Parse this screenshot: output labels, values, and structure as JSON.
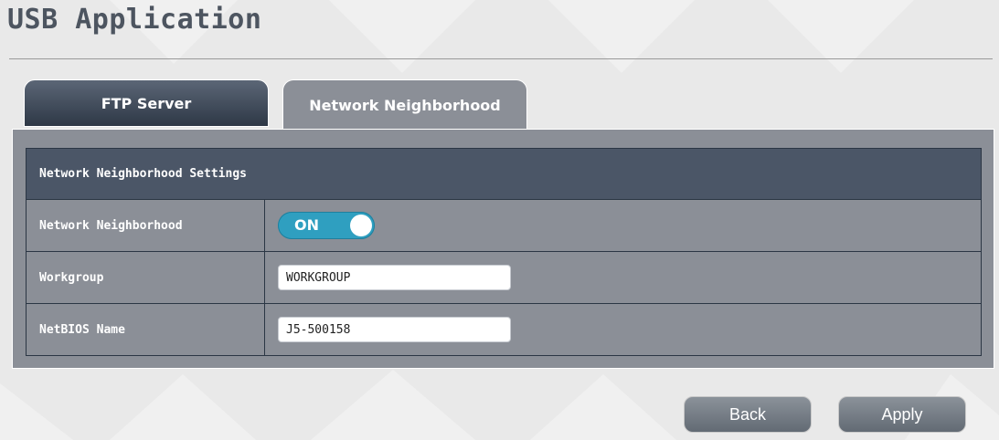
{
  "page": {
    "title": "USB Application"
  },
  "tabs": [
    {
      "label": "FTP Server",
      "active": false
    },
    {
      "label": "Network Neighborhood",
      "active": true
    }
  ],
  "settings": {
    "header": "Network Neighborhood Settings",
    "rows": {
      "network_neighborhood": {
        "label": "Network Neighborhood",
        "toggle_state": "ON"
      },
      "workgroup": {
        "label": "Workgroup",
        "value": "WORKGROUP"
      },
      "netbios_name": {
        "label": "NetBIOS Name",
        "value": "J5-500158"
      }
    }
  },
  "buttons": {
    "back": "Back",
    "apply": "Apply"
  },
  "colors": {
    "toggle_on": "#2f9fc0",
    "header_bg": "#4b5667",
    "panel_bg": "#8b8f97"
  }
}
